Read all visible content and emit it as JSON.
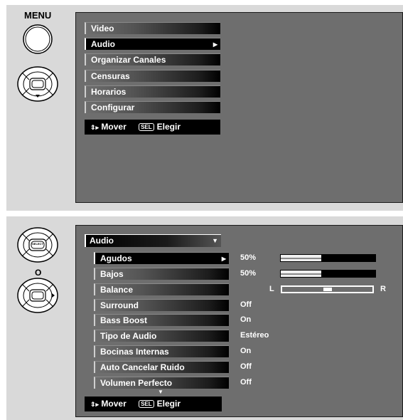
{
  "top_panel": {
    "menu_button_label": "MENU",
    "items": [
      {
        "label": "Video",
        "selected": false
      },
      {
        "label": "Audio",
        "selected": true
      },
      {
        "label": "Organizar Canales",
        "selected": false
      },
      {
        "label": "Censuras",
        "selected": false
      },
      {
        "label": "Horarios",
        "selected": false
      },
      {
        "label": "Configurar",
        "selected": false
      }
    ],
    "help": {
      "move": "Mover",
      "sel_key": "SEL",
      "choose": "Elegir"
    }
  },
  "bottom_panel": {
    "select_button_label": "SELECT",
    "or_label": "O",
    "dropdown_title": "Audio",
    "items": [
      {
        "label": "Agudos",
        "value": "50%",
        "selected": true
      },
      {
        "label": "Bajos",
        "value": "50%",
        "selected": false
      },
      {
        "label": "Balance",
        "value": "",
        "selected": false
      },
      {
        "label": "Surround",
        "value": "Off",
        "selected": false
      },
      {
        "label": "Bass Boost",
        "value": "On",
        "selected": false
      },
      {
        "label": "Tipo de Audio",
        "value": "Estéreo",
        "selected": false
      },
      {
        "label": "Bocinas Internas",
        "value": "On",
        "selected": false
      },
      {
        "label": "Auto Cancelar Ruido",
        "value": "Off",
        "selected": false
      },
      {
        "label": "Volumen Perfecto",
        "value": "Off",
        "selected": false
      }
    ],
    "agudos_level_pct": 50,
    "bajos_level_pct": 50,
    "balance": {
      "left_label": "L",
      "right_label": "R",
      "position_pct": 50
    },
    "help": {
      "move": "Mover",
      "sel_key": "SEL",
      "choose": "Elegir"
    }
  },
  "colors": {
    "panel_bg": "#d9d9d9",
    "screen_bg": "#6e6e6e",
    "menu_black": "#000000"
  }
}
